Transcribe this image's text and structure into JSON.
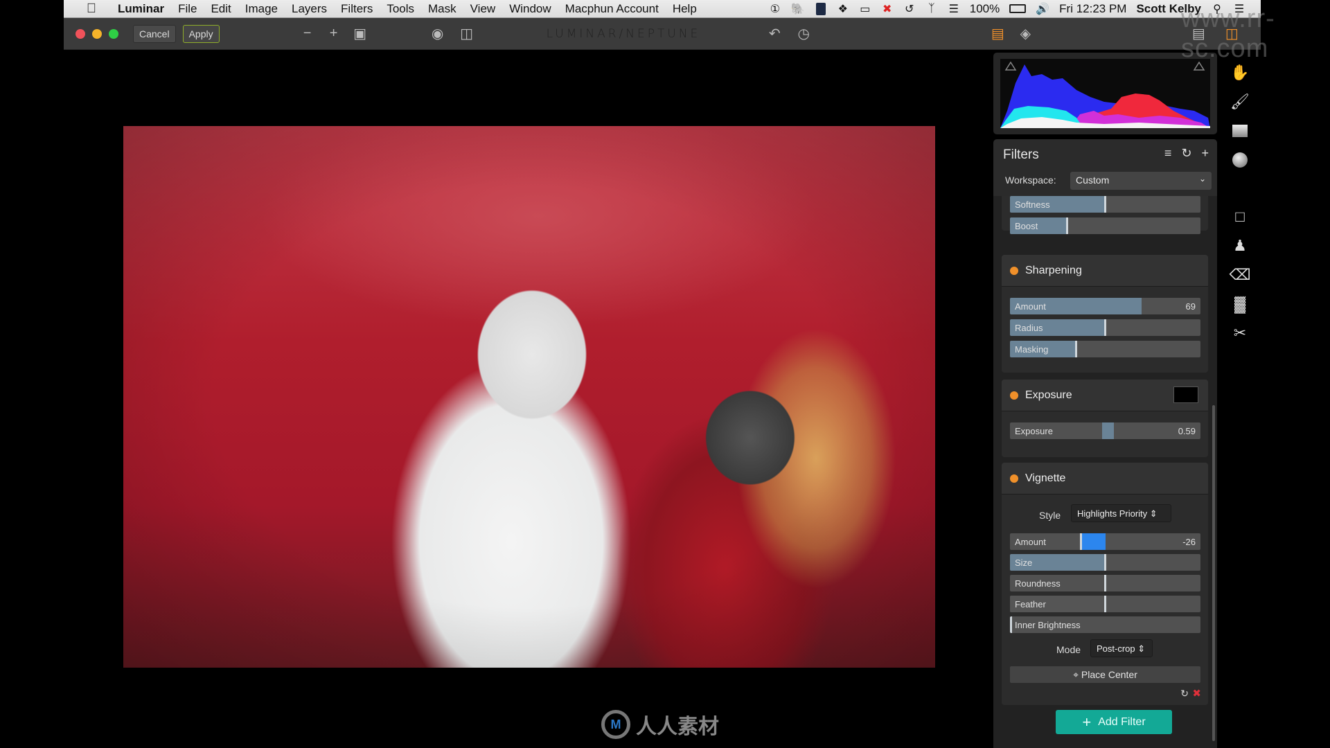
{
  "menubar": {
    "app_name": "Luminar",
    "items": [
      "File",
      "Edit",
      "Image",
      "Layers",
      "Filters",
      "Tools",
      "Mask",
      "View",
      "Window",
      "Macphun Account",
      "Help"
    ],
    "status_icons": [
      "1password-icon",
      "evernote-icon",
      "istat-icon",
      "dropbox-icon",
      "airplay-icon",
      "display-disabled-icon",
      "time-machine-icon",
      "bluetooth-icon",
      "wifi-icon"
    ],
    "battery": "100%",
    "clock": "Fri 12:23 PM",
    "user": "Scott Kelby"
  },
  "toolbar": {
    "cancel_label": "Cancel",
    "apply_label": "Apply",
    "brand": "LUMINAR/NEPTUNE",
    "accent": "#f0902a"
  },
  "filters_panel": {
    "title": "Filters",
    "workspace_label": "Workspace:",
    "workspace_value": "Custom",
    "partial_sliders": [
      {
        "label": "Softness",
        "value": 50
      },
      {
        "label": "Boost",
        "value": 30
      }
    ],
    "sharpening": {
      "title": "Sharpening",
      "sliders": [
        {
          "label": "Amount",
          "value": 69,
          "display": "69"
        },
        {
          "label": "Radius",
          "value": 50
        },
        {
          "label": "Masking",
          "value": 35
        }
      ]
    },
    "exposure": {
      "title": "Exposure",
      "sliders": [
        {
          "label": "Exposure",
          "value": 0.59,
          "display": "0.59"
        }
      ]
    },
    "vignette": {
      "title": "Vignette",
      "style_label": "Style",
      "style_value": "Highlights Priority",
      "sliders": [
        {
          "label": "Amount",
          "value": -26,
          "display": "-26"
        },
        {
          "label": "Size",
          "value": 50
        },
        {
          "label": "Roundness",
          "value": 0
        },
        {
          "label": "Feather",
          "value": 50
        },
        {
          "label": "Inner Brightness",
          "value": 0
        }
      ],
      "mode_label": "Mode",
      "mode_value": "Post-crop",
      "place_center_label": "Place Center"
    },
    "add_filter_label": "Add Filter",
    "add_filter_color": "#13a996"
  },
  "watermark": {
    "text": "人人素材",
    "url": "www.rr-sc.com"
  }
}
